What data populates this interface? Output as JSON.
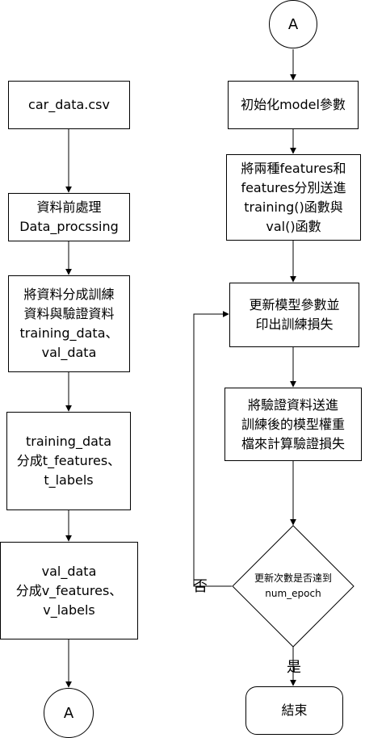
{
  "diagram": {
    "left_column": {
      "connector_bottom": "A",
      "step1": "car_data.csv",
      "step2": "資料前處理\nData_procssing",
      "step3": "將資料分成訓練\n資料與驗證資料\ntraining_data、\nval_data",
      "step4": "training_data\n分成t_features、\nt_labels",
      "step5": "val_data\n分成v_features、\nv_labels"
    },
    "right_column": {
      "connector_top": "A",
      "step1": "初始化model參數",
      "step2": "將兩種features和\nfeatures分別送進\ntraining()函數與\nval()函數",
      "step3": "更新模型參數並\n印出訓練損失",
      "step4": "將驗證資料送進\n訓練後的模型權重\n檔來計算驗證損失",
      "decision": "更新次數是否達到\nnum_epoch",
      "no_label": "否",
      "yes_label": "是",
      "end": "結束"
    }
  }
}
